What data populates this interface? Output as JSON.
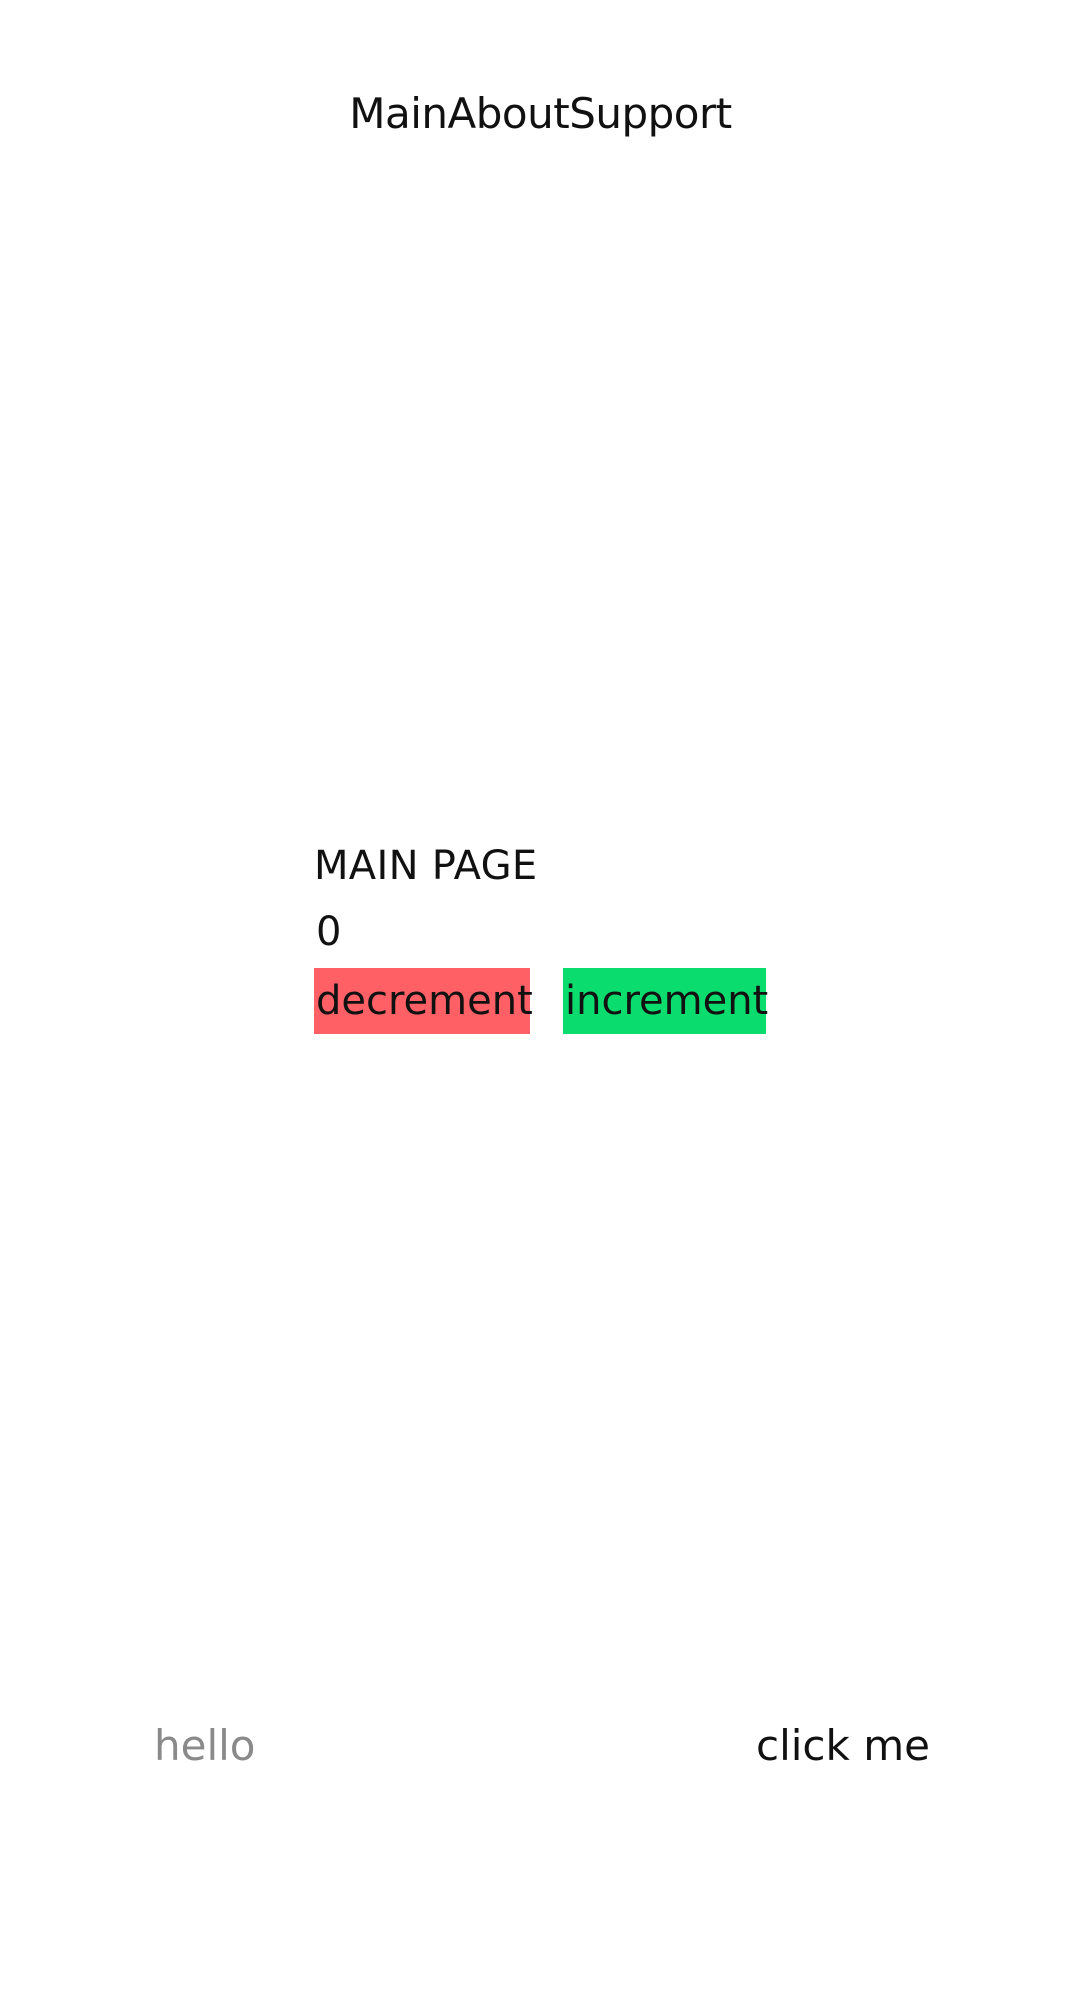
{
  "nav": {
    "items": [
      {
        "label": "Main"
      },
      {
        "label": "About"
      },
      {
        "label": "Support"
      }
    ]
  },
  "main": {
    "title": "MAIN PAGE",
    "count": "0",
    "decrement_label": "decrement",
    "increment_label": "increment"
  },
  "footer": {
    "left_text": "hello",
    "button_label": "click me"
  },
  "colors": {
    "decrement_bg": "#ff6066",
    "increment_bg": "#0adc6e",
    "muted_text": "#8a8a8a",
    "text": "#111111",
    "background": "#ffffff"
  }
}
